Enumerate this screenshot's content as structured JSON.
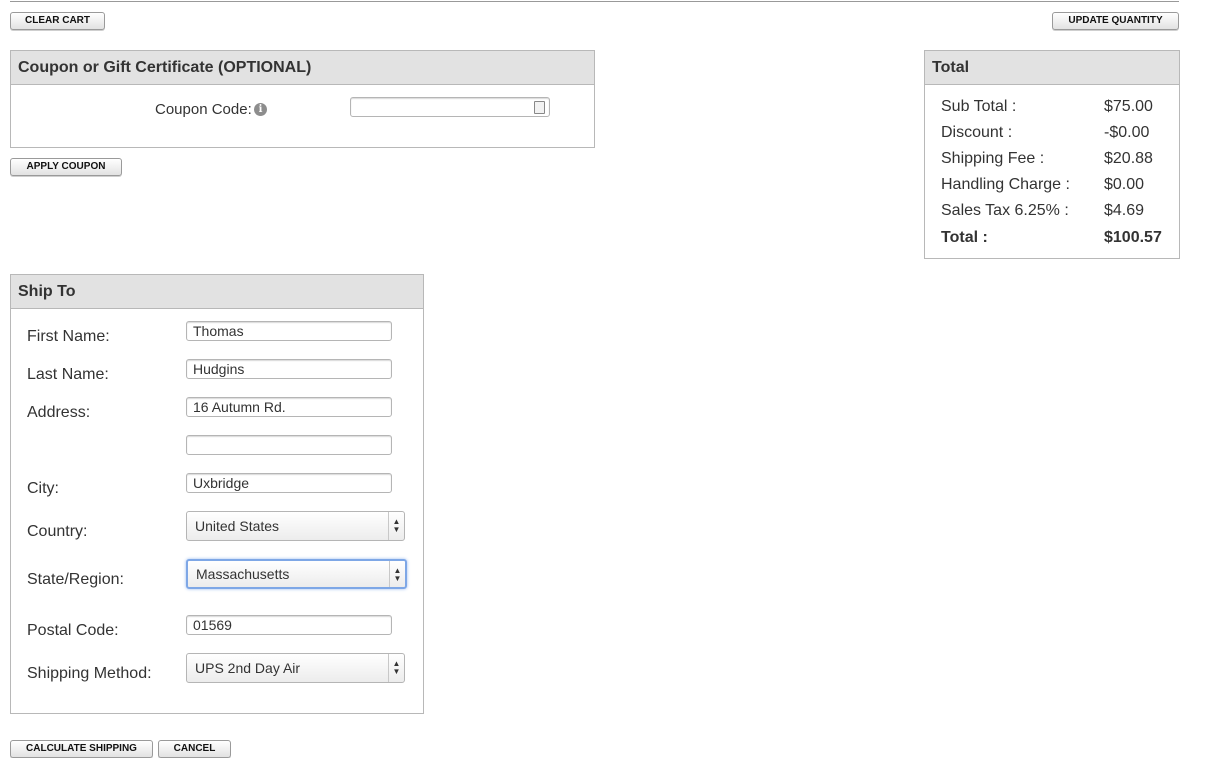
{
  "buttons": {
    "clear_cart": "CLEAR CART",
    "update_quantity": "UPDATE QUANTITY",
    "apply_coupon": "APPLY COUPON",
    "calculate_shipping": "CALCULATE SHIPPING",
    "cancel": "CANCEL"
  },
  "coupon": {
    "title": "Coupon or Gift Certificate (OPTIONAL)",
    "label": "Coupon Code:",
    "value": "",
    "info_icon": "info-icon",
    "field_icon": "contact-card-icon"
  },
  "totals": {
    "title": "Total",
    "rows": [
      {
        "label": "Sub Total :",
        "value": "$75.00"
      },
      {
        "label": "Discount :",
        "value": "-$0.00"
      },
      {
        "label": "Shipping Fee :",
        "value": "$20.88"
      },
      {
        "label": "Handling Charge :",
        "value": "$0.00"
      },
      {
        "label": "Sales Tax 6.25% :",
        "value": "$4.69"
      },
      {
        "label": "Total :",
        "value": "$100.57"
      }
    ]
  },
  "ship_to": {
    "title": "Ship To",
    "first_name": {
      "label": "First Name:",
      "value": "Thomas"
    },
    "last_name": {
      "label": "Last Name:",
      "value": "Hudgins"
    },
    "address": {
      "label": "Address:",
      "value": "16 Autumn Rd.",
      "value2": ""
    },
    "city": {
      "label": "City:",
      "value": "Uxbridge"
    },
    "country": {
      "label": "Country:",
      "value": "United States"
    },
    "state": {
      "label": "State/Region:",
      "value": "Massachusetts"
    },
    "postal": {
      "label": "Postal Code:",
      "value": "01569"
    },
    "shipping_method": {
      "label": "Shipping Method:",
      "value": "UPS 2nd Day Air"
    }
  },
  "colors": {
    "panel_header": "#e2e2e2",
    "border": "#b8b8b8",
    "focus": "#7ea7e6"
  }
}
